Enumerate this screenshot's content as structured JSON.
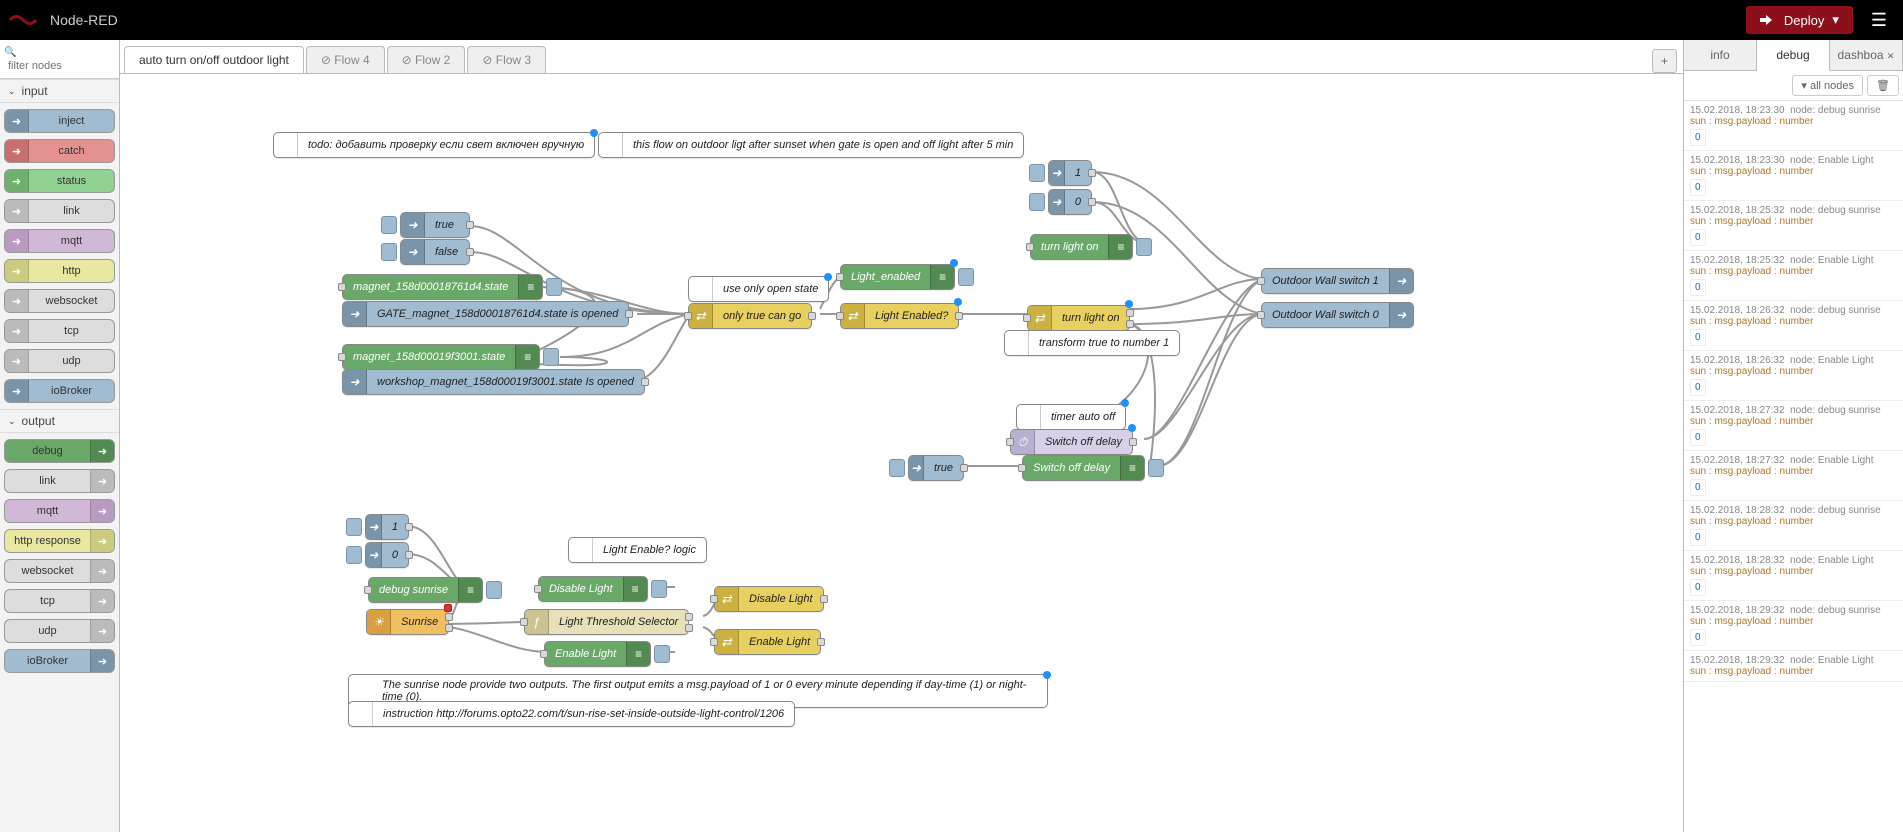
{
  "header": {
    "title": "Node-RED",
    "deploy": "Deploy"
  },
  "palette": {
    "filter_placeholder": "filter nodes",
    "cat_input": "input",
    "input_nodes": [
      {
        "label": "inject",
        "cls": "c-blue"
      },
      {
        "label": "catch",
        "cls": "c-red"
      },
      {
        "label": "status",
        "cls": "c-green"
      },
      {
        "label": "link",
        "cls": "c-grey"
      },
      {
        "label": "mqtt",
        "cls": "c-purple"
      },
      {
        "label": "http",
        "cls": "c-olive"
      },
      {
        "label": "websocket",
        "cls": "c-grey"
      },
      {
        "label": "tcp",
        "cls": "c-grey"
      },
      {
        "label": "udp",
        "cls": "c-grey"
      },
      {
        "label": "ioBroker",
        "cls": "c-blue"
      }
    ],
    "cat_output": "output",
    "output_nodes": [
      {
        "label": "debug",
        "cls": "c-dgreen"
      },
      {
        "label": "link",
        "cls": "c-grey"
      },
      {
        "label": "mqtt",
        "cls": "c-purple"
      },
      {
        "label": "http response",
        "cls": "c-olive"
      },
      {
        "label": "websocket",
        "cls": "c-grey"
      },
      {
        "label": "tcp",
        "cls": "c-grey"
      },
      {
        "label": "udp",
        "cls": "c-grey"
      },
      {
        "label": "ioBroker",
        "cls": "c-blue"
      }
    ]
  },
  "tabs": {
    "t1": "auto turn on/off outdoor light",
    "t2": "⊘ Flow 4",
    "t3": "⊘ Flow 2",
    "t4": "⊘ Flow 3",
    "add": "+"
  },
  "nodes": {
    "comment1": "todo: добавить проверку если свет включен вручную",
    "comment2": "this flow on outdoor ligt after sunset when gate is open and off light after 5 min",
    "inj_true": "true",
    "inj_false": "false",
    "magnet1": "magnet_158d00018761d4.state",
    "gate_magnet": "GATE_magnet_158d00018761d4.state is opened",
    "magnet2": "magnet_158d00019f3001.state",
    "workshop_magnet": "workshop_magnet_158d00019f3001.state Is opened",
    "use_open": "use only open state",
    "only_true": "only true can go",
    "light_enabled_dbg": "Light_enabled",
    "light_enabled_q": "Light Enabled?",
    "inj_1": "1",
    "inj_0": "0",
    "turn_on_dbg": "turn light on",
    "turn_on_sw": "turn light on",
    "transform": "transform true to number 1",
    "timer_auto": "timer auto off",
    "switch_off_delay1": "Switch off delay",
    "switch_off_delay2": "Switch off delay",
    "inj_true2": "true",
    "outdoor1": "Outdoor Wall switch 1",
    "outdoor0": "Outdoor Wall switch 0",
    "inj_1b": "1",
    "inj_0b": "0",
    "debug_sunrise": "debug sunrise",
    "sunrise": "Sunrise",
    "light_enable_logic": "Light Enable? logic",
    "disable_light_dbg": "Disable Light",
    "lts": "Light Threshold Selector",
    "enable_light_dbg": "Enable Light",
    "disable_light": "Disable Light",
    "enable_light": "Enable Light",
    "sunrise_desc": "The sunrise node provide two outputs. The first output emits a msg.payload of 1 or 0 every minute depending if day-time (1) or night-time (0).",
    "instruction": "instruction http://forums.opto22.com/t/sun-rise-set-inside-outside-light-control/1206"
  },
  "sidebar": {
    "tab_info": "info",
    "tab_debug": "debug",
    "tab_dash": "dashboa",
    "all_nodes": "all nodes",
    "msgs": [
      {
        "ts": "15.02.2018, 18:23:30",
        "node": "node: debug sunrise",
        "topic": "sun : msg.payload : number",
        "val": "0"
      },
      {
        "ts": "15.02.2018, 18:23:30",
        "node": "node: Enable Light",
        "topic": "sun : msg.payload : number",
        "val": "0"
      },
      {
        "ts": "15.02.2018, 18:25:32",
        "node": "node: debug sunrise",
        "topic": "sun : msg.payload : number",
        "val": "0"
      },
      {
        "ts": "15.02.2018, 18:25:32",
        "node": "node: Enable Light",
        "topic": "sun : msg.payload : number",
        "val": "0"
      },
      {
        "ts": "15.02.2018, 18:26:32",
        "node": "node: debug sunrise",
        "topic": "sun : msg.payload : number",
        "val": "0"
      },
      {
        "ts": "15.02.2018, 18:26:32",
        "node": "node: Enable Light",
        "topic": "sun : msg.payload : number",
        "val": "0"
      },
      {
        "ts": "15.02.2018, 18:27:32",
        "node": "node: debug sunrise",
        "topic": "sun : msg.payload : number",
        "val": "0"
      },
      {
        "ts": "15.02.2018, 18:27:32",
        "node": "node: Enable Light",
        "topic": "sun : msg.payload : number",
        "val": "0"
      },
      {
        "ts": "15.02.2018, 18:28:32",
        "node": "node: debug sunrise",
        "topic": "sun : msg.payload : number",
        "val": "0"
      },
      {
        "ts": "15.02.2018, 18:28:32",
        "node": "node: Enable Light",
        "topic": "sun : msg.payload : number",
        "val": "0"
      },
      {
        "ts": "15.02.2018, 18:29:32",
        "node": "node: debug sunrise",
        "topic": "sun : msg.payload : number",
        "val": "0"
      },
      {
        "ts": "15.02.2018, 18:29:32",
        "node": "node: Enable Light",
        "topic": "sun : msg.payload : number",
        "val": ""
      }
    ]
  }
}
